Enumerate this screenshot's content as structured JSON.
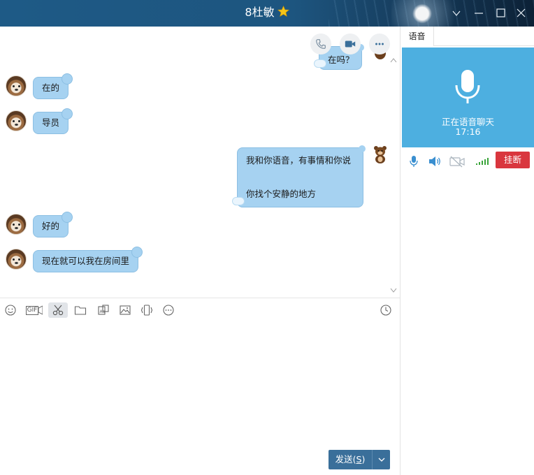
{
  "titlebar": {
    "title": "8杜敏",
    "icons": {
      "star": "star-icon",
      "dropdown": "chevron-down-icon",
      "minimize": "minimize-icon",
      "maximize": "maximize-icon",
      "close": "close-icon"
    }
  },
  "chat_actions": {
    "icons": [
      "phone-icon",
      "video-call-icon",
      "more-icon"
    ]
  },
  "messages": [
    {
      "side": "right",
      "lines": [
        "在吗？"
      ],
      "partial": true
    },
    {
      "side": "left",
      "lines": [
        "在的"
      ]
    },
    {
      "side": "left",
      "lines": [
        "导员"
      ]
    },
    {
      "side": "right",
      "lines": [
        "我和你语音，有事情和你说",
        "你找个安静的地方"
      ]
    },
    {
      "side": "left",
      "lines": [
        "好的"
      ]
    },
    {
      "side": "left",
      "lines": [
        "现在就可以我在房间里"
      ]
    }
  ],
  "toolbar": {
    "icons": [
      "emoji-icon",
      "gif-icon",
      "screenshot-scissors-icon",
      "folder-icon",
      "sticker-icon",
      "image-icon",
      "shake-icon",
      "more-options-icon",
      "history-clock-icon"
    ],
    "gif_label": "GIF"
  },
  "send": {
    "label": "发送(",
    "hotkey": "S",
    "label_end": ")"
  },
  "right_panel": {
    "tab_label": "语音",
    "voice_status": "正在语音聊天",
    "call_timer": "17:16",
    "controls": [
      "microphone-icon",
      "speaker-icon",
      "camera-off-icon",
      "signal-strength-icon"
    ],
    "hangup_label": "挂断"
  },
  "colors": {
    "bubble": "#a6d2f1",
    "voice_card": "#4dafe0",
    "hangup": "#d9363e",
    "send_button": "#3a6f9a",
    "titlebar": "#1e5a86"
  }
}
